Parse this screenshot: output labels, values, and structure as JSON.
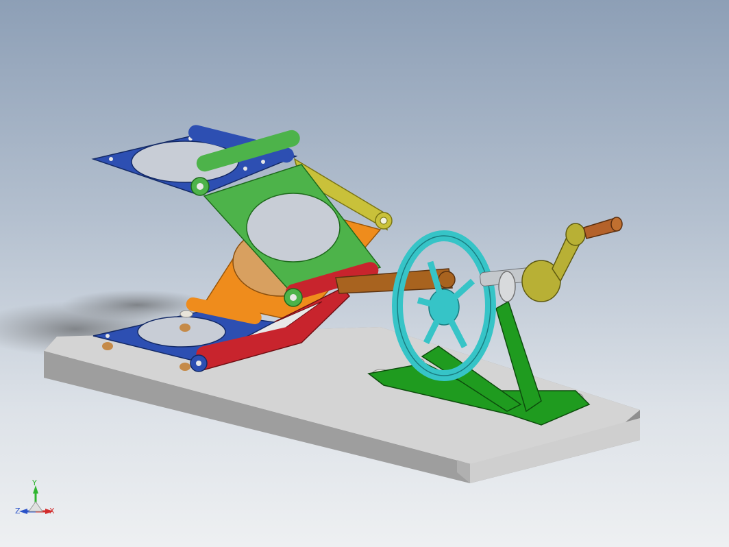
{
  "viewport": {
    "background_top": "#8d9fb6",
    "background_bottom": "#eef0f2"
  },
  "model": {
    "parts": [
      {
        "name": "base-plate",
        "color": "#d9d9d9"
      },
      {
        "name": "top-platform",
        "color": "#2d4fb2"
      },
      {
        "name": "bottom-platform",
        "color": "#2d4fb2"
      },
      {
        "name": "middle-plate",
        "color": "#4db34a"
      },
      {
        "name": "back-plate",
        "color": "#ef8c1c"
      },
      {
        "name": "lower-link",
        "color": "#c8242d"
      },
      {
        "name": "upper-link",
        "color": "#c9c13a"
      },
      {
        "name": "drive-rod",
        "color": "#a8631f"
      },
      {
        "name": "handwheel",
        "color": "#36c4c7"
      },
      {
        "name": "support-stand",
        "color": "#1f9b1f"
      },
      {
        "name": "crank-handle",
        "color": "#b8b035"
      },
      {
        "name": "knob",
        "color": "#b4622a"
      }
    ]
  },
  "triad": {
    "y_label": "Y",
    "z_label": "Z",
    "x_label": "X",
    "y_color": "#2fb52f",
    "z_color": "#2a52c8",
    "x_color": "#d22b2b"
  }
}
